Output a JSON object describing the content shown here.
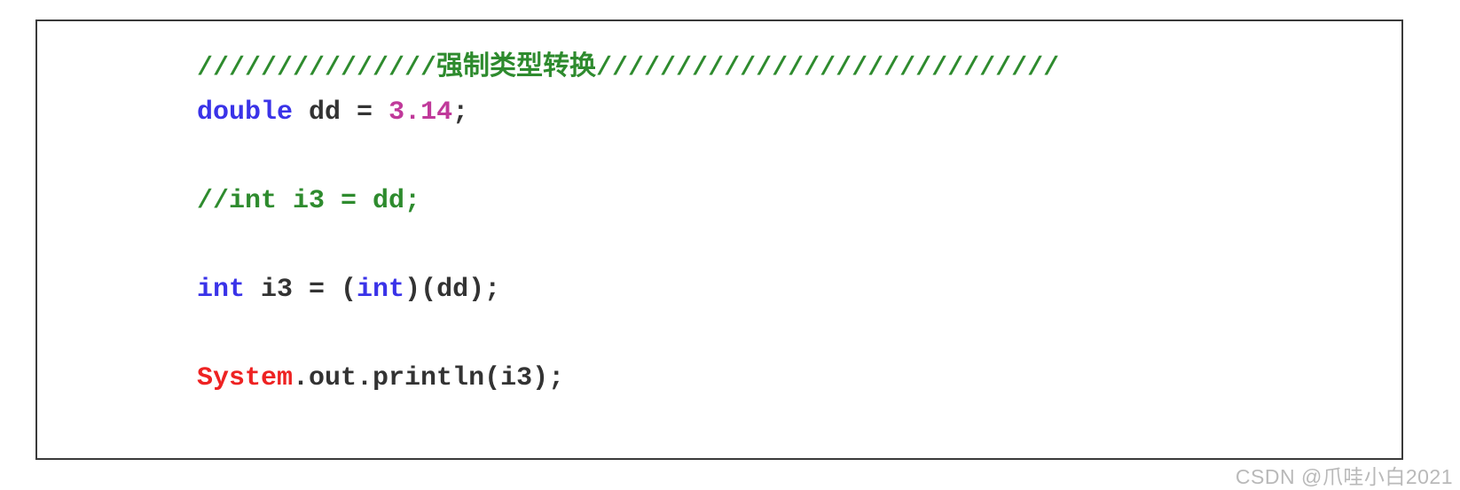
{
  "code_block": {
    "language": "java",
    "border_color": "#3a3a3a",
    "background": "#ffffff",
    "syntax_colors": {
      "comment": "#2e8b2e",
      "keyword": "#3a33e8",
      "plain": "#333333",
      "number": "#c0399a",
      "class": "#ee2222"
    },
    "lines": [
      {
        "index": 0,
        "overflows_right_border": true,
        "tokens": [
          {
            "type": "comment",
            "text": "///////////////强制类型转换/////////////////////////////"
          }
        ]
      },
      {
        "index": 1,
        "tokens": [
          {
            "type": "keyword",
            "text": "double"
          },
          {
            "type": "plain",
            "text": " dd "
          },
          {
            "type": "plain",
            "text": "= "
          },
          {
            "type": "number",
            "text": "3.14"
          },
          {
            "type": "plain",
            "text": ";"
          }
        ]
      },
      {
        "index": 2,
        "blank": true,
        "tokens": []
      },
      {
        "index": 3,
        "tokens": [
          {
            "type": "comment",
            "text": "//int i3 = dd;"
          }
        ]
      },
      {
        "index": 4,
        "blank": true,
        "tokens": []
      },
      {
        "index": 5,
        "tokens": [
          {
            "type": "keyword",
            "text": "int"
          },
          {
            "type": "plain",
            "text": " i3 = ("
          },
          {
            "type": "keyword",
            "text": "int"
          },
          {
            "type": "plain",
            "text": ")(dd);"
          }
        ]
      },
      {
        "index": 6,
        "blank": true,
        "tokens": []
      },
      {
        "index": 7,
        "tokens": [
          {
            "type": "class",
            "text": "System"
          },
          {
            "type": "plain",
            "text": ".out.println(i3);"
          }
        ]
      }
    ]
  },
  "watermark": {
    "text": "CSDN @爪哇小白2021",
    "color": "#b9b9b9"
  }
}
